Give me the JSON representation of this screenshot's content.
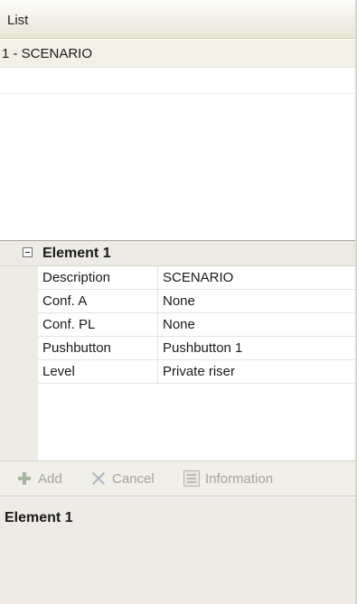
{
  "list": {
    "header": "List",
    "items": [
      {
        "label": "1 - SCENARIO"
      }
    ]
  },
  "property_grid": {
    "category": {
      "label": "Element 1",
      "expanded": true
    },
    "rows": [
      {
        "name": "Description",
        "value": "SCENARIO"
      },
      {
        "name": "Conf. A",
        "value": "None"
      },
      {
        "name": "Conf. PL",
        "value": "None"
      },
      {
        "name": "Pushbutton",
        "value": "Pushbutton 1"
      },
      {
        "name": "Level",
        "value": "Private riser"
      }
    ]
  },
  "toolbar": {
    "add_label": "Add",
    "cancel_label": "Cancel",
    "information_label": "Information",
    "icons": {
      "add": "plus-icon",
      "cancel": "cross-icon",
      "information": "info-icon"
    },
    "enabled": false
  },
  "description_panel": {
    "title": "Element 1"
  },
  "colors": {
    "selected_row": "#f2f1e6",
    "grid_gutter": "#ecebe6",
    "disabled_text": "#a4a39c"
  }
}
